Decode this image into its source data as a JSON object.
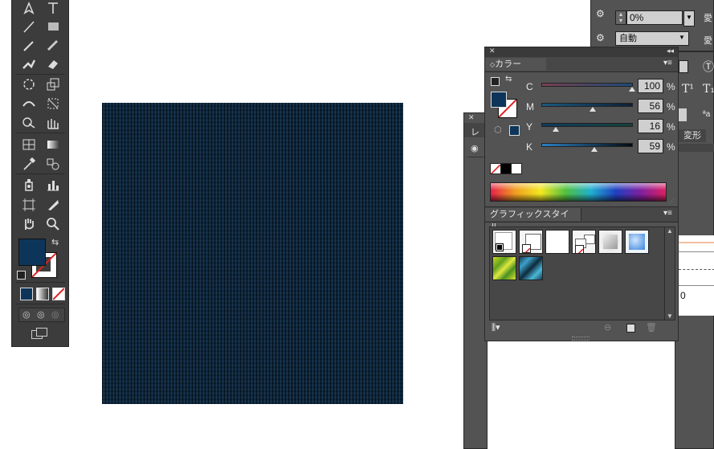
{
  "colors": {
    "fill": "#0d355a",
    "panel": "#535353",
    "toolbar": "#3c3c3c"
  },
  "color_panel": {
    "title": "カラー",
    "channels": [
      {
        "label": "C",
        "value": "100",
        "unit": "%"
      },
      {
        "label": "M",
        "value": "56",
        "unit": "%"
      },
      {
        "label": "Y",
        "value": "16",
        "unit": "%"
      },
      {
        "label": "K",
        "value": "59",
        "unit": "%"
      }
    ]
  },
  "graphic_styles_panel": {
    "title": "グラフィックスタイル"
  },
  "top_panel": {
    "opacity_value": "0%",
    "auto_label": "自動"
  },
  "transform_tab": {
    "label": "変形"
  },
  "layers_panel": {
    "title": "レ"
  },
  "left_partial": {
    "value": "0"
  },
  "toolbox": {
    "tools": [
      "pen-tool",
      "type-tool",
      "line-tool",
      "rectangle-tool",
      "paintbrush-tool",
      "pencil-tool",
      "blob-brush-tool",
      "eraser-tool",
      "rotate-tool",
      "scale-tool",
      "width-tool",
      "free-transform-tool",
      "shape-builder-tool",
      "perspective-grid-tool",
      "mesh-tool",
      "gradient-tool",
      "eyedropper-tool",
      "blend-tool",
      "symbol-sprayer-tool",
      "column-graph-tool",
      "artboard-tool",
      "slice-tool",
      "hand-tool",
      "zoom-tool"
    ]
  }
}
